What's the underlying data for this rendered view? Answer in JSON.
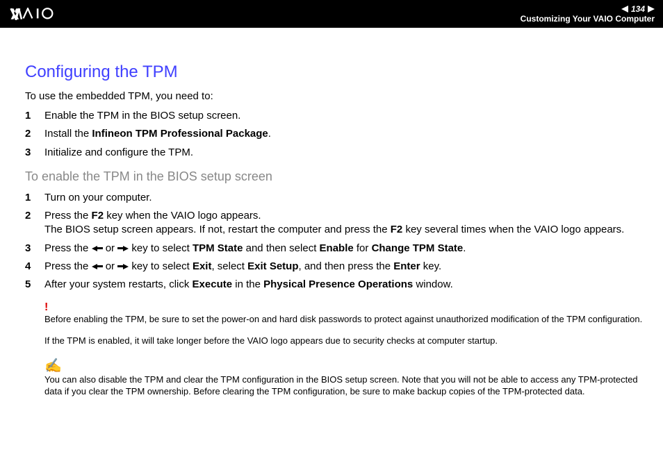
{
  "header": {
    "page_number": "134",
    "section": "Customizing Your VAIO Computer"
  },
  "title": "Configuring the TPM",
  "intro": "To use the embedded TPM, you need to:",
  "steps_a": [
    {
      "num": "1",
      "parts": [
        {
          "t": "Enable the TPM in the BIOS setup screen."
        }
      ]
    },
    {
      "num": "2",
      "parts": [
        {
          "t": "Install the "
        },
        {
          "t": "Infineon TPM Professional Package",
          "b": true
        },
        {
          "t": "."
        }
      ]
    },
    {
      "num": "3",
      "parts": [
        {
          "t": "Initialize and configure the TPM."
        }
      ]
    }
  ],
  "subtitle": "To enable the TPM in the BIOS setup screen",
  "steps_b": [
    {
      "num": "1",
      "parts": [
        {
          "t": "Turn on your computer."
        }
      ]
    },
    {
      "num": "2",
      "parts": [
        {
          "t": "Press the "
        },
        {
          "t": "F2",
          "b": true
        },
        {
          "t": " key when the VAIO logo appears."
        },
        {
          "br": true
        },
        {
          "t": "The BIOS setup screen appears. If not, restart the computer and press the "
        },
        {
          "t": "F2",
          "b": true
        },
        {
          "t": " key several times when the VAIO logo appears."
        }
      ]
    },
    {
      "num": "3",
      "parts": [
        {
          "t": "Press the "
        },
        {
          "arrow": "left"
        },
        {
          "t": " or "
        },
        {
          "arrow": "right"
        },
        {
          "t": " key to select "
        },
        {
          "t": "TPM State",
          "b": true
        },
        {
          "t": " and then select "
        },
        {
          "t": "Enable",
          "b": true
        },
        {
          "t": " for "
        },
        {
          "t": "Change TPM State",
          "b": true
        },
        {
          "t": "."
        }
      ]
    },
    {
      "num": "4",
      "parts": [
        {
          "t": "Press the "
        },
        {
          "arrow": "left"
        },
        {
          "t": " or "
        },
        {
          "arrow": "right"
        },
        {
          "t": " key to select "
        },
        {
          "t": "Exit",
          "b": true
        },
        {
          "t": ", select "
        },
        {
          "t": "Exit Setup",
          "b": true
        },
        {
          "t": ", and then press the "
        },
        {
          "t": "Enter",
          "b": true
        },
        {
          "t": " key."
        }
      ]
    },
    {
      "num": "5",
      "parts": [
        {
          "t": "After your system restarts, click "
        },
        {
          "t": "Execute",
          "b": true
        },
        {
          "t": " in the "
        },
        {
          "t": "Physical Presence Operations",
          "b": true
        },
        {
          "t": " window."
        }
      ]
    }
  ],
  "warn1": "Before enabling the TPM, be sure to set the power-on and hard disk passwords to protect against unauthorized modification of the TPM configuration.",
  "warn2": "If the TPM is enabled, it will take longer before the VAIO logo appears due to security checks at computer startup.",
  "tip": "You can also disable the TPM and clear the TPM configuration in the BIOS setup screen. Note that you will not be able to access any TPM-protected data if you clear the TPM ownership. Before clearing the TPM configuration, be sure to make backup copies of the TPM-protected data."
}
